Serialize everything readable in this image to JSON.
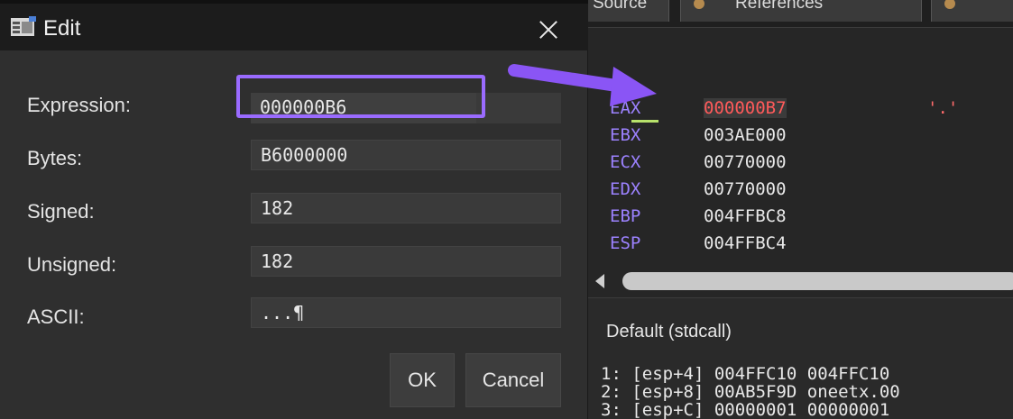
{
  "background_window": {
    "tabs": [
      {
        "label": "Source"
      },
      {
        "label": "References"
      }
    ],
    "registers": [
      {
        "name": "EAX",
        "value": "000000B7",
        "extra": "'.'",
        "changed": true
      },
      {
        "name": "EBX",
        "value": "003AE000"
      },
      {
        "name": "ECX",
        "value": "00770000"
      },
      {
        "name": "EDX",
        "value": "00770000"
      },
      {
        "name": "EBP",
        "value": "004FFBC8"
      },
      {
        "name": "ESP",
        "value": "004FFBC4"
      }
    ],
    "call_convention": "Default (stdcall)",
    "stack": [
      {
        "text": "1: [esp+4] 004FFC10 004FFC10"
      },
      {
        "text": "2: [esp+8] 00AB5F9D oneetx.00"
      },
      {
        "text": "3: [esp+C] 00000001 00000001"
      }
    ],
    "colors": {
      "register_name": "#9c82ff",
      "changed_value": "#ff5a5a",
      "underline": "#b7e16b"
    }
  },
  "dialog": {
    "title": "Edit",
    "icons": {
      "title": "edit-window-icon",
      "close": "close-icon"
    },
    "fields": {
      "expression": {
        "label": "Expression:",
        "value": "000000B6"
      },
      "bytes": {
        "label": "Bytes:",
        "value": "B6000000"
      },
      "signed": {
        "label": "Signed:",
        "value": "182"
      },
      "unsigned": {
        "label": "Unsigned:",
        "value": "182"
      },
      "ascii": {
        "label": "ASCII:",
        "value": "...¶"
      }
    },
    "buttons": {
      "ok": "OK",
      "cancel": "Cancel"
    },
    "colors": {
      "highlight": "#9a6bff",
      "arrow": "#8a55f5"
    }
  }
}
